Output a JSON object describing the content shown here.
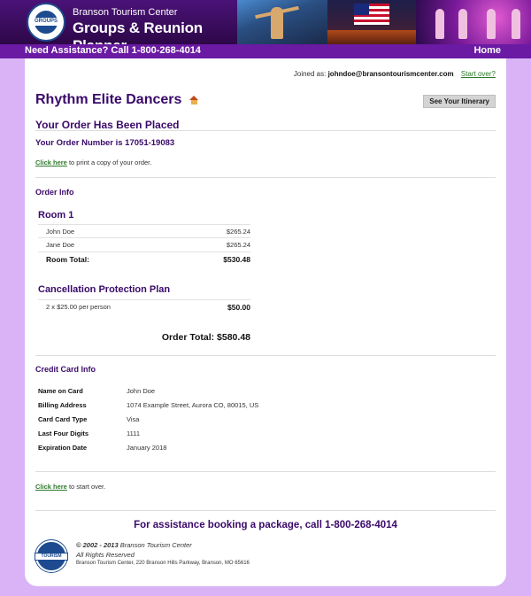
{
  "header": {
    "brand_top": "Branson Tourism Center",
    "brand_main": "Groups & Reunion Planner",
    "logo_text": "GROUPS",
    "assistance": "Need Assistance? Call 1-800-268-4014",
    "home": "Home"
  },
  "account": {
    "joined_prefix": "Joined as:",
    "email": "johndoe@bransontourismcenter.com",
    "start_over": "Start over?"
  },
  "show": {
    "title": "Rhythm Elite Dancers",
    "itinerary_button": "See Your Itinerary"
  },
  "confirmation": {
    "placed": "Your Order Has Been Placed",
    "order_number": "Your Order Number is 17051-19083",
    "print_link": "Click here",
    "print_text": " to print a copy of your order."
  },
  "order_info": {
    "heading": "Order Info",
    "room": {
      "title": "Room 1",
      "guests": [
        {
          "name": "John Doe",
          "price": "$265.24"
        },
        {
          "name": "Jane Doe",
          "price": "$265.24"
        }
      ],
      "total_label": "Room Total:",
      "total_value": "$530.48"
    },
    "cancellation": {
      "title": "Cancellation Protection Plan",
      "line": "2 x $25.00 per person",
      "value": "$50.00"
    },
    "order_total": "Order Total: $580.48"
  },
  "credit_card": {
    "heading": "Credit Card Info",
    "rows": [
      {
        "label": "Name on Card",
        "value": "John Doe"
      },
      {
        "label": "Billing Address",
        "value": "1074 Example Street, Aurora CO, 80015, US"
      },
      {
        "label": "Card Card Type",
        "value": "Visa"
      },
      {
        "label": "Last Four Digits",
        "value": "1111"
      },
      {
        "label": "Expiration Date",
        "value": "January 2018"
      }
    ]
  },
  "start_over": {
    "link": "Click here",
    "text": " to start over."
  },
  "footer": {
    "assistance": "For assistance booking a package, call 1-800-268-4014",
    "copyright_years": "© 2002 - 2013",
    "copyright_name": " Branson Tourism Center",
    "rights": "All Rights Reserved",
    "address": "Branson Tourism Center, 220 Branson Hills Parkway, Branson, MO 65616",
    "logo_text": "TOURISM"
  },
  "colors": {
    "page_bg": "#d9b3f5",
    "accent_purple": "#3a0a6a",
    "nav_purple": "#6a1aa3",
    "link_green": "#2a7a2a"
  }
}
